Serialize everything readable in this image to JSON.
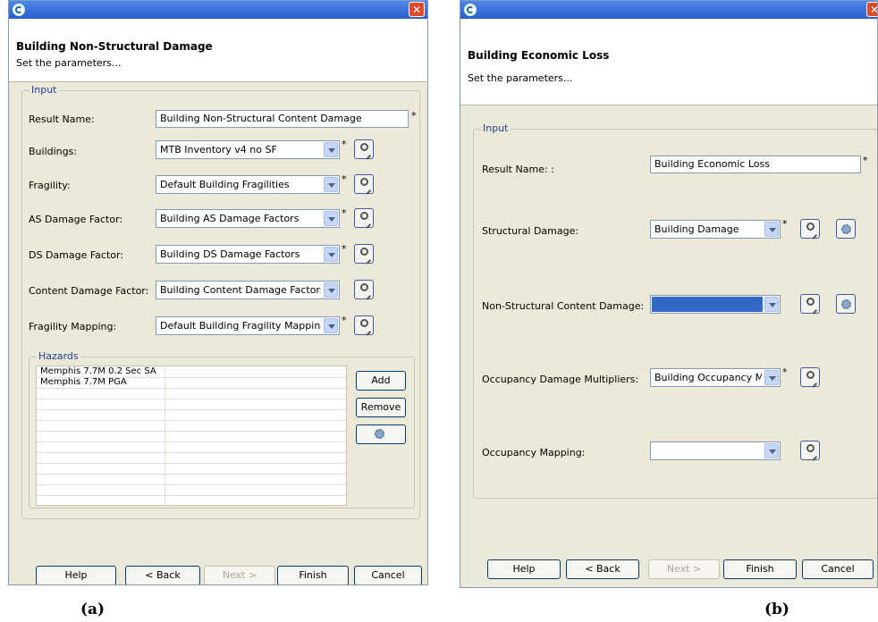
{
  "figure_fragment": "g",
  "dialogs": [
    {
      "title": "Building Non-Structural Damage",
      "subtitle": "Set the parameters...",
      "group_label": "Input",
      "fields": [
        {
          "label": "Result Name:",
          "value": "Building Non-Structural Content Damage"
        },
        {
          "label": "Buildings:",
          "value": "MTB Inventory v4 no SF"
        },
        {
          "label": "Fragility:",
          "value": "Default Building Fragilities"
        },
        {
          "label": "AS Damage Factor:",
          "value": "Building AS Damage Factors"
        },
        {
          "label": "DS Damage Factor:",
          "value": "Building DS Damage Factors"
        },
        {
          "label": "Content Damage Factor:",
          "value": "Building Content Damage Factors"
        },
        {
          "label": "Fragility Mapping:",
          "value": "Default Building Fragility Mapping"
        }
      ],
      "required_mark": "*",
      "hazards_label": "Hazards",
      "hazards": [
        "Memphis 7.7M 0.2 Sec SA",
        "Memphis 7.7M PGA"
      ],
      "hazard_buttons": {
        "add": "Add",
        "remove": "Remove"
      },
      "buttons": {
        "help": "Help",
        "back": "< Back",
        "next": "Next >",
        "finish": "Finish",
        "cancel": "Cancel"
      },
      "caption": "(a)"
    },
    {
      "title": "Building Economic Loss",
      "subtitle": "Set the parameters...",
      "group_label": "Input",
      "fields": [
        {
          "label": "Result Name: :",
          "value": "Building Economic Loss"
        },
        {
          "label": "Structural Damage:",
          "value": "Building Damage"
        },
        {
          "label": "Non-Structural Content Damage:",
          "value": ""
        },
        {
          "label": "Occupancy Damage Multipliers:",
          "value": "Building Occupancy Mul"
        },
        {
          "label": "Occupancy Mapping:",
          "value": ""
        }
      ],
      "required_mark": "*",
      "buttons": {
        "help": "Help",
        "back": "< Back",
        "next": "Next >",
        "finish": "Finish",
        "cancel": "Cancel"
      },
      "caption": "(b)"
    }
  ],
  "icons": {
    "search": "magnifier-icon",
    "settings": "gear-icon",
    "close": "close-icon",
    "app": "app-logo-icon"
  },
  "colors": {
    "titlebar": "#2a5fcc",
    "dialog_bg": "#ece9d8",
    "selection": "#316ac5",
    "group_label": "#1d3f8e"
  }
}
